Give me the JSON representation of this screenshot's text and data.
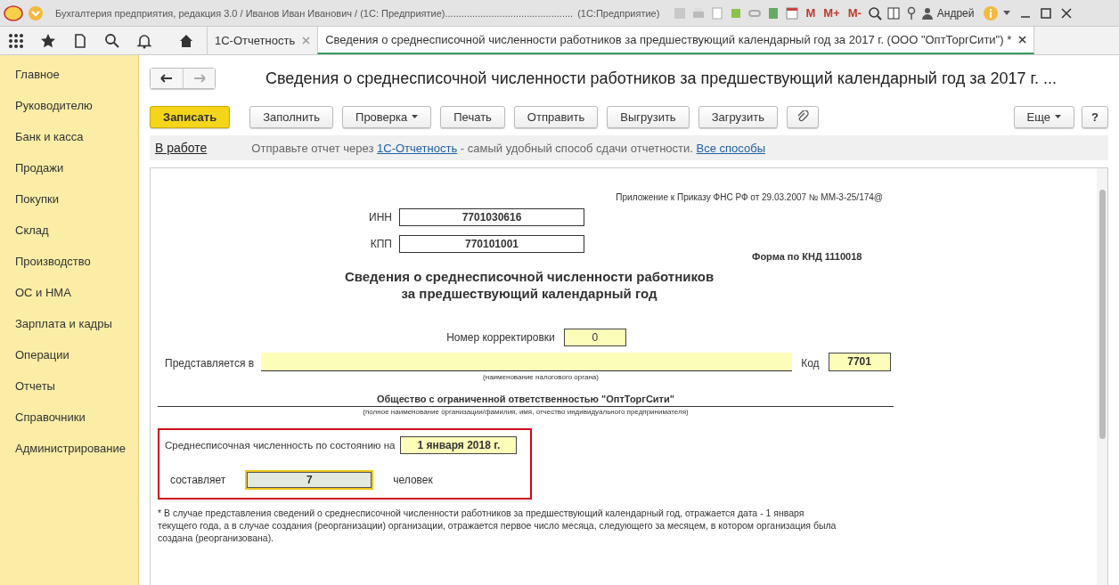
{
  "title_bar": {
    "app_title": "Бухгалтерия предприятия, редакция 3.0 / Иванов Иван Иванович / (1С: Предприятие)...............................................",
    "app_tail": "(1С:Предприятие)",
    "memory_buttons": [
      "M",
      "M+",
      "M-"
    ],
    "user": "Андрей"
  },
  "tabs": [
    {
      "label": "1С-Отчетность",
      "selected": false
    },
    {
      "label": "Сведения о среднесписочной численности работников за предшествующий календарный год за 2017 г. (ООО \"ОптТоргСити\") *",
      "selected": true
    }
  ],
  "sidebar": {
    "items": [
      {
        "label": "Главное",
        "selected": false
      },
      {
        "label": "Руководителю",
        "selected": false
      },
      {
        "label": "Банк и касса",
        "selected": false
      },
      {
        "label": "Продажи",
        "selected": false
      },
      {
        "label": "Покупки",
        "selected": false
      },
      {
        "label": "Склад",
        "selected": false
      },
      {
        "label": "Производство",
        "selected": false
      },
      {
        "label": "ОС и НМА",
        "selected": false
      },
      {
        "label": "Зарплата и кадры",
        "selected": false
      },
      {
        "label": "Операции",
        "selected": false
      },
      {
        "label": "Отчеты",
        "selected": false
      },
      {
        "label": "Справочники",
        "selected": false
      },
      {
        "label": "Администрирование",
        "selected": false
      }
    ]
  },
  "document": {
    "title": "Сведения о среднесписочной численности работников за предшествующий календарный год за 2017 г. ...",
    "toolbar": [
      {
        "label": "Записать",
        "kind": "primary"
      },
      {
        "label": "Заполнить",
        "kind": "plain"
      },
      {
        "label": "Проверка",
        "kind": "dropdown"
      },
      {
        "label": "Печать",
        "kind": "plain"
      },
      {
        "label": "Отправить",
        "kind": "plain"
      },
      {
        "label": "Выгрузить",
        "kind": "plain"
      },
      {
        "label": "Загрузить",
        "kind": "plain"
      },
      {
        "kind": "attach"
      }
    ],
    "toolbar_right": [
      {
        "label": "Еще",
        "kind": "dropdown"
      },
      {
        "label": "?",
        "kind": "plain"
      }
    ],
    "status": "В работе",
    "message": {
      "before": "Отправьте отчет через",
      "link": "1С-Отчетность",
      "after": "- самый удобный способ сдачи отчетности.",
      "link2": "Все способы"
    }
  },
  "form": {
    "appendix": "Приложение к Приказу ФНС РФ от 29.03.2007 № ММ-3-25/174@",
    "inn_label": "ИНН",
    "inn": "7701030616",
    "kpp_label": "КПП",
    "kpp": "770101001",
    "knd": "Форма по КНД 1110018",
    "heading": [
      "Сведения о среднесписочной численности работников",
      "за предшествующий календарный год"
    ],
    "correction_label": "Номер корректировки",
    "correction": "0",
    "submitted_label": "Представляется в",
    "submitted_caption": "(наименование налогового органа)",
    "code_label": "Код",
    "code": "7701",
    "org_name": "Общество с ограниченной ответственностью \"ОптТоргСити\"",
    "org_caption": "(полное наименование организации/фамилия, имя, отчество индивидуального предпринимателя)",
    "headcount_label": "Среднесписочная численность по состоянию на",
    "date": "1 января 2018 г.",
    "amount_label": "составляет",
    "count": "7",
    "unit": "человек",
    "footnote": "* В случае представления сведений о среднесписочной численности работников за предшествующий календарный год, отражается дата - 1 января текущего года, а в случае создания (реорганизации) организации, отражается первое число месяца, следующего за месяцем, в котором организация была создана (реорганизована)."
  }
}
